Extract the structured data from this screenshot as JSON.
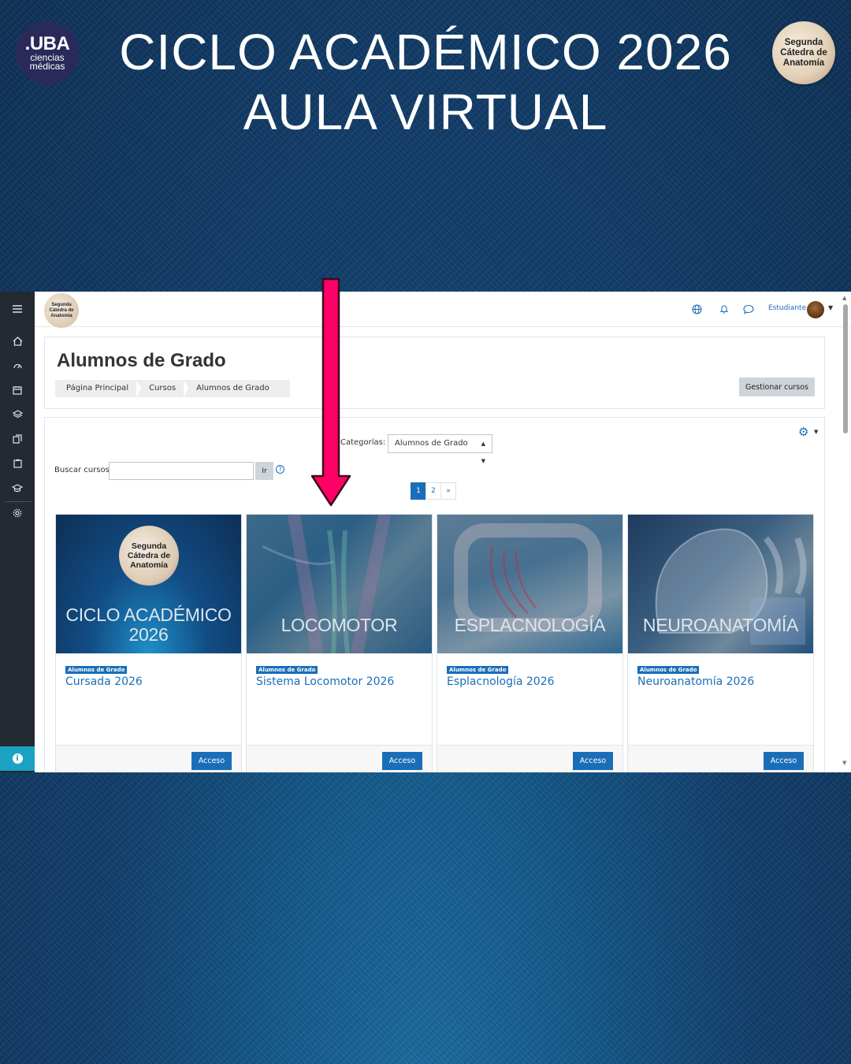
{
  "poster": {
    "logo_main": ".UBA",
    "logo_sub1": "ciencias",
    "logo_sub2": "médicas",
    "title_line1": "CICLO ACADÉMICO 2026",
    "title_line2": "AULA VIRTUAL",
    "badge_line1": "Segunda",
    "badge_line2": "Cátedra de",
    "badge_line3": "Anatomía"
  },
  "topbar": {
    "logo_text": "Segunda Cátedra de Anatomía",
    "icons": [
      "globe-icon",
      "bell-icon",
      "chat-icon"
    ],
    "user_name": "Estudiante"
  },
  "sidebar": {
    "icons": [
      "menu-icon",
      "home-icon",
      "dashboard-icon",
      "calendar-icon",
      "layers-icon",
      "files-icon",
      "clipboard-icon",
      "graduation-cap-icon",
      "gear-icon"
    ],
    "info_icon": "info-icon"
  },
  "page": {
    "heading": "Alumnos de Grado",
    "breadcrumb": [
      "Página Principal",
      "Cursos",
      "Alumnos de Grado"
    ],
    "manage_button": "Gestionar cursos"
  },
  "filters": {
    "category_label": "Categorías:",
    "category_selected": "Alumnos de Grado",
    "search_label": "Buscar cursos",
    "search_value": "",
    "go_button": "Ir",
    "pages": [
      "1",
      "2",
      "»"
    ],
    "current_page": "1"
  },
  "courses": [
    {
      "image_title_1": "CICLO ACADÉMICO",
      "image_title_2": "2026",
      "image_badge": "Segunda Cátedra de Anatomía",
      "category": "Alumnos de Grado",
      "name": "Cursada 2026",
      "button": "Acceso"
    },
    {
      "image_title_1": "LOCOMOTOR",
      "category": "Alumnos de Grado",
      "name": "Sistema Locomotor 2026",
      "button": "Acceso"
    },
    {
      "image_title_1": "ESPLACNOLOGÍA",
      "category": "Alumnos de Grado",
      "name": "Esplacnología 2026",
      "button": "Acceso"
    },
    {
      "image_title_1": "NEUROANATOMÍA",
      "category": "Alumnos de Grado",
      "name": "Neuroanatomía 2026",
      "button": "Acceso"
    }
  ],
  "colors": {
    "accent": "#1a6eb8",
    "arrow": "#ff0066",
    "sidebar": "#232a31",
    "info": "#1aa3c4"
  }
}
